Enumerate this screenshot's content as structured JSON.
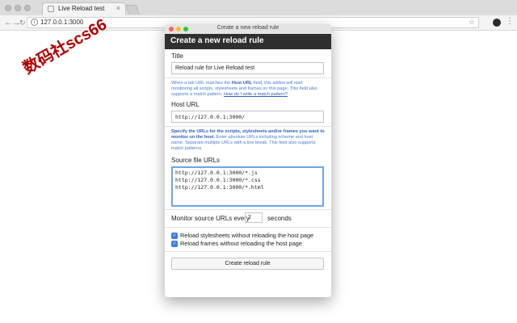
{
  "browser": {
    "tab_title": "Live Reload test",
    "url": "127.0.0.1:3000"
  },
  "watermark": "数码社scs66",
  "popup": {
    "window_title": "Create a new reload rule",
    "heading": "Create a new reload rule",
    "title_label": "Title",
    "title_value": "Reload rule for Live Reload test",
    "host_help_1": "When a tab URL matches the ",
    "host_help_bold": "Host URL",
    "host_help_2": " field, this addon will start monitoring all scripts, stylesheets and frames on this page. This field also supports a match pattern. ",
    "host_help_link": "How do I write a match pattern?",
    "host_label": "Host URL",
    "host_value": "http://127.0.0.1:3000/",
    "source_help_bold": "Specify the URLs for the scripts, stylesheets and/or frames you want to monitor on the host.",
    "source_help_2": " Enter absolute URLs including scheme and host name. Separate multiple URLs with a line break. This field also supports match patterns.",
    "source_label": "Source file URLs",
    "source_lines": [
      "http://127.0.0.1:3000/*.js",
      "http://127.0.0.1:3000/*.css",
      "http://127.0.0.1:3000/*.html"
    ],
    "monitor_label": "Monitor source URLs every",
    "monitor_value": "2",
    "seconds_label": "seconds",
    "check_stylesheets": "Reload stylesheets without reloading the host page",
    "check_frames": "Reload frames without reloading the host page",
    "create_button": "Create reload rule"
  },
  "colors": {
    "header_bg": "#2f2f2f",
    "help_text": "#4a7bd0",
    "focus_border": "#6aa6e8",
    "checkbox": "#3a7ee4",
    "close_dot": "#fc5f57",
    "minimize_dot": "#fdbc2e",
    "zoom_dot": "#28c840"
  },
  "icons": [
    "back-arrow-icon",
    "forward-arrow-icon",
    "reload-icon",
    "info-icon",
    "star-icon",
    "extension-icon",
    "menu-icon",
    "checkmark-icon"
  ]
}
